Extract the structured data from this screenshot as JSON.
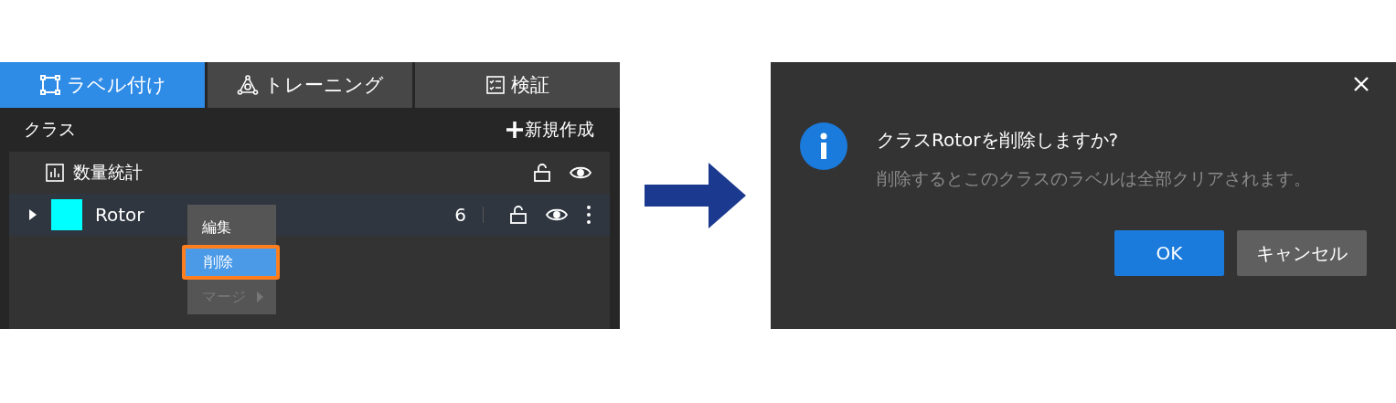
{
  "tabs": [
    {
      "label": "ラベル付け",
      "selected": true
    },
    {
      "label": "トレーニング",
      "selected": false
    },
    {
      "label": "検証",
      "selected": false
    }
  ],
  "class_panel": {
    "title": "クラス",
    "new_button": "新規作成",
    "stats_label": "数量統計",
    "classes": [
      {
        "name": "Rotor",
        "color": "#00ffff",
        "count": "6",
        "expanded": false
      }
    ]
  },
  "context_menu": {
    "items": [
      {
        "label": "編集",
        "selected": false,
        "disabled": false,
        "outlined": false,
        "submenu": false
      },
      {
        "label": "削除",
        "selected": true,
        "disabled": false,
        "outlined": true,
        "submenu": false
      },
      {
        "label": "マージ",
        "selected": false,
        "disabled": true,
        "outlined": false,
        "submenu": true
      }
    ]
  },
  "dialog": {
    "title": "クラスRotorを削除しますか?",
    "message": "削除するとこのクラスのラベルは全部クリアされます。",
    "buttons": [
      {
        "label": "OK",
        "kind": "primary"
      },
      {
        "label": "キャンセル",
        "kind": "secondary"
      }
    ]
  }
}
